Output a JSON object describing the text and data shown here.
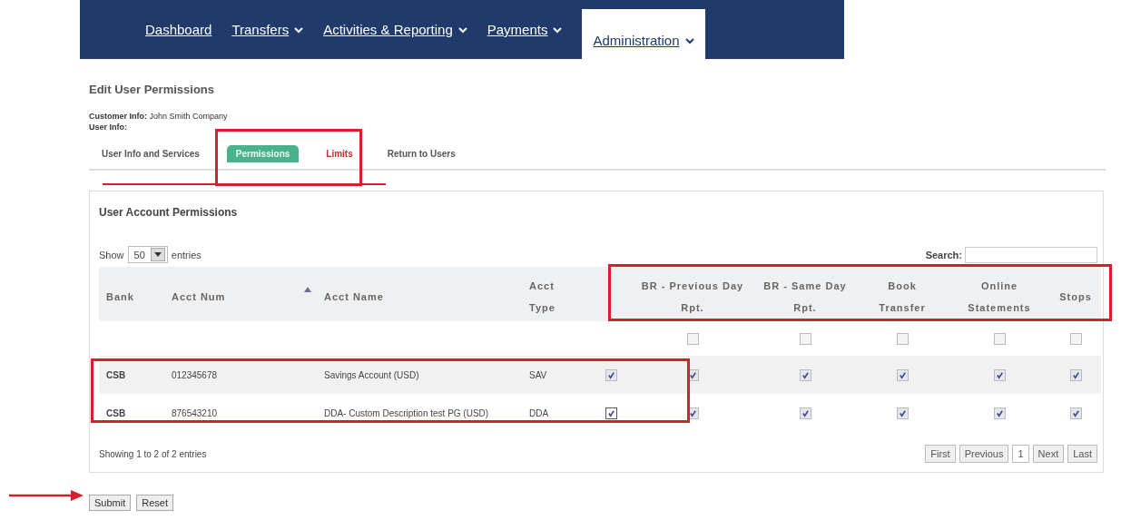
{
  "nav": [
    {
      "label": "Dashboard",
      "dropdown": false,
      "selected": false
    },
    {
      "label": "Transfers",
      "dropdown": true,
      "selected": false
    },
    {
      "label": "Activities & Reporting",
      "dropdown": true,
      "selected": false
    },
    {
      "label": "Payments",
      "dropdown": true,
      "selected": false
    },
    {
      "label": "Administration",
      "dropdown": true,
      "selected": true
    }
  ],
  "page_title": "Edit User Permissions",
  "customer_info": {
    "label": "Customer Info:",
    "value": "John Smith Company"
  },
  "user_info": {
    "label": "User Info:"
  },
  "tabs": [
    {
      "label": "User Info and Services",
      "selected": false
    },
    {
      "label": "Permissions",
      "selected": true
    },
    {
      "label": "Limits",
      "selected": false
    },
    {
      "label": "Return to Users",
      "selected": false
    }
  ],
  "panel_title": "User Account Permissions",
  "show_entries": {
    "prefix": "Show",
    "value": "50",
    "suffix": "entries"
  },
  "search": {
    "label": "Search:"
  },
  "table": {
    "columns": [
      "Bank",
      "Acct Num",
      "Acct Name",
      "Acct Type",
      "",
      "BR - Previous Day Rpt.",
      "BR - Same Day Rpt.",
      "Book Transfer",
      "Online Statements",
      "Stops"
    ],
    "select_all": [
      false,
      false,
      false,
      false,
      false
    ],
    "rows": [
      {
        "bank": "CSB",
        "acct_num": "012345678",
        "acct_name": "Savings Account (USD)",
        "acct_type": "SAV",
        "checks": [
          true,
          true,
          true,
          true,
          true,
          true
        ]
      },
      {
        "bank": "CSB",
        "acct_num": "876543210",
        "acct_name": "DDA- Custom Description test PG (USD)",
        "acct_type": "DDA",
        "checks": [
          true,
          true,
          true,
          true,
          true,
          true
        ]
      }
    ]
  },
  "info": "Showing 1 to 2 of 2 entries",
  "pager": [
    {
      "label": "First",
      "selected": false
    },
    {
      "label": "Previous",
      "selected": false
    },
    {
      "label": "1",
      "selected": true
    },
    {
      "label": "Next",
      "selected": false
    },
    {
      "label": "Last",
      "selected": false
    }
  ],
  "buttons": [
    "Submit",
    "Reset"
  ]
}
